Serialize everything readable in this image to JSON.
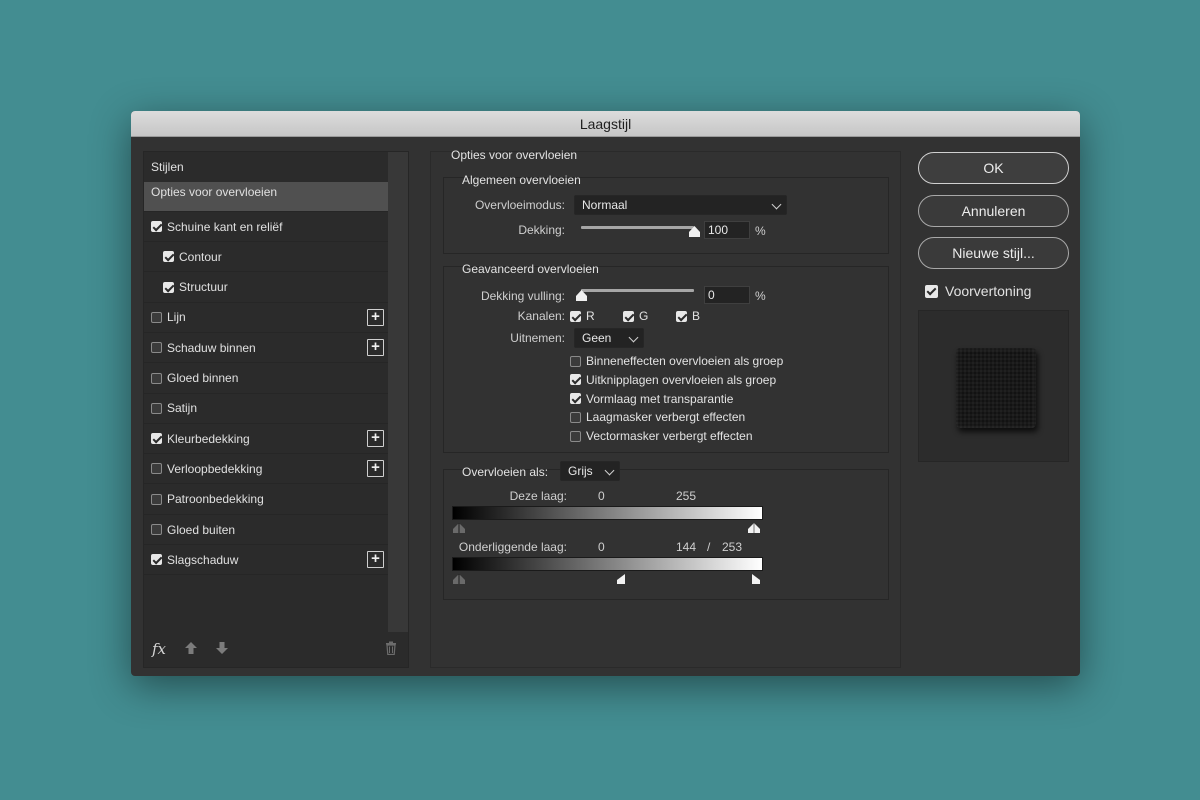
{
  "window": {
    "title": "Laagstijl"
  },
  "styles_panel": {
    "header": "Stijlen",
    "selected": "Opties voor overvloeien",
    "items": [
      {
        "label": "Schuine kant en reliëf",
        "checked": true,
        "indent": false,
        "plus": false
      },
      {
        "label": "Contour",
        "checked": true,
        "indent": true,
        "plus": false
      },
      {
        "label": "Structuur",
        "checked": true,
        "indent": true,
        "plus": false
      },
      {
        "label": "Lijn",
        "checked": false,
        "indent": false,
        "plus": true
      },
      {
        "label": "Schaduw binnen",
        "checked": false,
        "indent": false,
        "plus": true
      },
      {
        "label": "Gloed binnen",
        "checked": false,
        "indent": false,
        "plus": false
      },
      {
        "label": "Satijn",
        "checked": false,
        "indent": false,
        "plus": false
      },
      {
        "label": "Kleurbedekking",
        "checked": true,
        "indent": false,
        "plus": true
      },
      {
        "label": "Verloopbedekking",
        "checked": false,
        "indent": false,
        "plus": true
      },
      {
        "label": "Patroonbedekking",
        "checked": false,
        "indent": false,
        "plus": false
      },
      {
        "label": "Gloed buiten",
        "checked": false,
        "indent": false,
        "plus": false
      },
      {
        "label": "Slagschaduw",
        "checked": true,
        "indent": false,
        "plus": true
      }
    ],
    "footer": {
      "fx": "fx"
    }
  },
  "blending": {
    "title": "Opties voor overvloeien",
    "general": {
      "title": "Algemeen overvloeien",
      "mode_label": "Overvloeimodus:",
      "mode_value": "Normaal",
      "opacity_label": "Dekking:",
      "opacity_value": "100",
      "opacity_unit": "%",
      "opacity_level": 1.0
    },
    "advanced": {
      "title": "Geavanceerd overvloeien",
      "fill_label": "Dekking vulling:",
      "fill_value": "0",
      "fill_unit": "%",
      "fill_level": 0.0,
      "channels_label": "Kanalen:",
      "channels": [
        {
          "label": "R",
          "checked": true
        },
        {
          "label": "G",
          "checked": true
        },
        {
          "label": "B",
          "checked": true
        }
      ],
      "knockout_label": "Uitnemen:",
      "knockout_value": "Geen",
      "options": [
        {
          "label": "Binneneffecten overvloeien als groep",
          "checked": false
        },
        {
          "label": "Uitknipplagen overvloeien als groep",
          "checked": true
        },
        {
          "label": "Vormlaag met transparantie",
          "checked": true
        },
        {
          "label": "Laagmasker verbergt effecten",
          "checked": false
        },
        {
          "label": "Vectormasker verbergt effecten",
          "checked": false
        }
      ]
    },
    "blend_if": {
      "label": "Overvloeien als:",
      "value": "Grijs",
      "this_layer": {
        "label": "Deze laag:",
        "low": "0",
        "high": "255"
      },
      "underlying": {
        "label": "Onderliggende laag:",
        "low": "0",
        "high_a": "144",
        "sep": "/",
        "high_b": "253"
      }
    }
  },
  "buttons": {
    "ok": "OK",
    "cancel": "Annuleren",
    "new_style": "Nieuwe stijl..."
  },
  "preview": {
    "label": "Voorvertoning",
    "checked": true
  },
  "colors": {
    "background": "#438d91",
    "dialog": "#323232",
    "titlebar": "#d0d0d0"
  }
}
